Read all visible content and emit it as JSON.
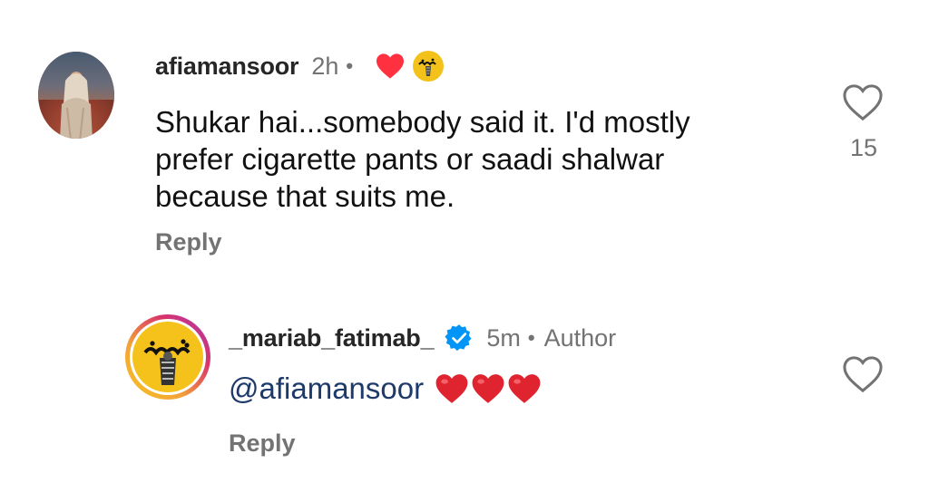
{
  "comment": {
    "username": "afiamansoor",
    "time": "2h",
    "separator": "•",
    "text": "Shukar hai...somebody said it. I'd mostly prefer cigarette pants or saadi shalwar because that suits me.",
    "reply_label": "Reply",
    "like_count": "15",
    "liked_by_author_icon": "heart-icon",
    "author_badge_icon": "mariab-logo-icon"
  },
  "reply": {
    "username": "_mariab_fatimab_",
    "verified_icon": "verified-badge-icon",
    "time": "5m",
    "separator": "•",
    "author_label": "Author",
    "mention": "@afiamansoor",
    "emojis": [
      "red-heart",
      "red-heart",
      "red-heart"
    ],
    "reply_label": "Reply"
  },
  "colors": {
    "heart_red": "#ff3040",
    "secondary_text": "#737373",
    "mention_blue": "#1e3a6b",
    "verified_blue": "#0095f6",
    "brand_yellow": "#f4c21b"
  }
}
